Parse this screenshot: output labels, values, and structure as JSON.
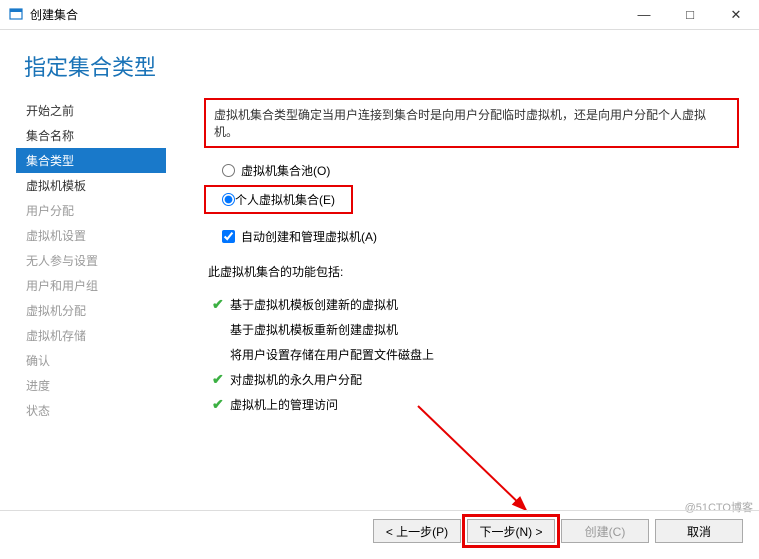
{
  "window": {
    "title": "创建集合",
    "minimize": "—",
    "maximize": "□",
    "close": "✕"
  },
  "heading": "指定集合类型",
  "sidebar": {
    "items": [
      {
        "label": "开始之前",
        "state": "enabled"
      },
      {
        "label": "集合名称",
        "state": "enabled"
      },
      {
        "label": "集合类型",
        "state": "active"
      },
      {
        "label": "虚拟机模板",
        "state": "enabled"
      },
      {
        "label": "用户分配",
        "state": "disabled"
      },
      {
        "label": "虚拟机设置",
        "state": "disabled"
      },
      {
        "label": "无人参与设置",
        "state": "disabled"
      },
      {
        "label": "用户和用户组",
        "state": "disabled"
      },
      {
        "label": "虚拟机分配",
        "state": "disabled"
      },
      {
        "label": "虚拟机存储",
        "state": "disabled"
      },
      {
        "label": "确认",
        "state": "disabled"
      },
      {
        "label": "进度",
        "state": "disabled"
      },
      {
        "label": "状态",
        "state": "disabled"
      }
    ]
  },
  "main": {
    "info": "虚拟机集合类型确定当用户连接到集合时是向用户分配临时虚拟机，还是向用户分配个人虚拟机。",
    "radio_pool": "虚拟机集合池(O)",
    "radio_personal": "个人虚拟机集合(E)",
    "checkbox_auto": "自动创建和管理虚拟机(A)",
    "features_title": "此虚拟机集合的功能包括:",
    "features": [
      {
        "check": true,
        "text": "基于虚拟机模板创建新的虚拟机"
      },
      {
        "check": false,
        "text": "基于虚拟机模板重新创建虚拟机"
      },
      {
        "check": false,
        "text": "将用户设置存储在用户配置文件磁盘上"
      },
      {
        "check": true,
        "text": "对虚拟机的永久用户分配"
      },
      {
        "check": true,
        "text": "虚拟机上的管理访问"
      }
    ]
  },
  "buttons": {
    "prev": "< 上一步(P)",
    "next": "下一步(N) >",
    "create": "创建(C)",
    "cancel": "取消"
  },
  "watermark": "@51CTO博客"
}
